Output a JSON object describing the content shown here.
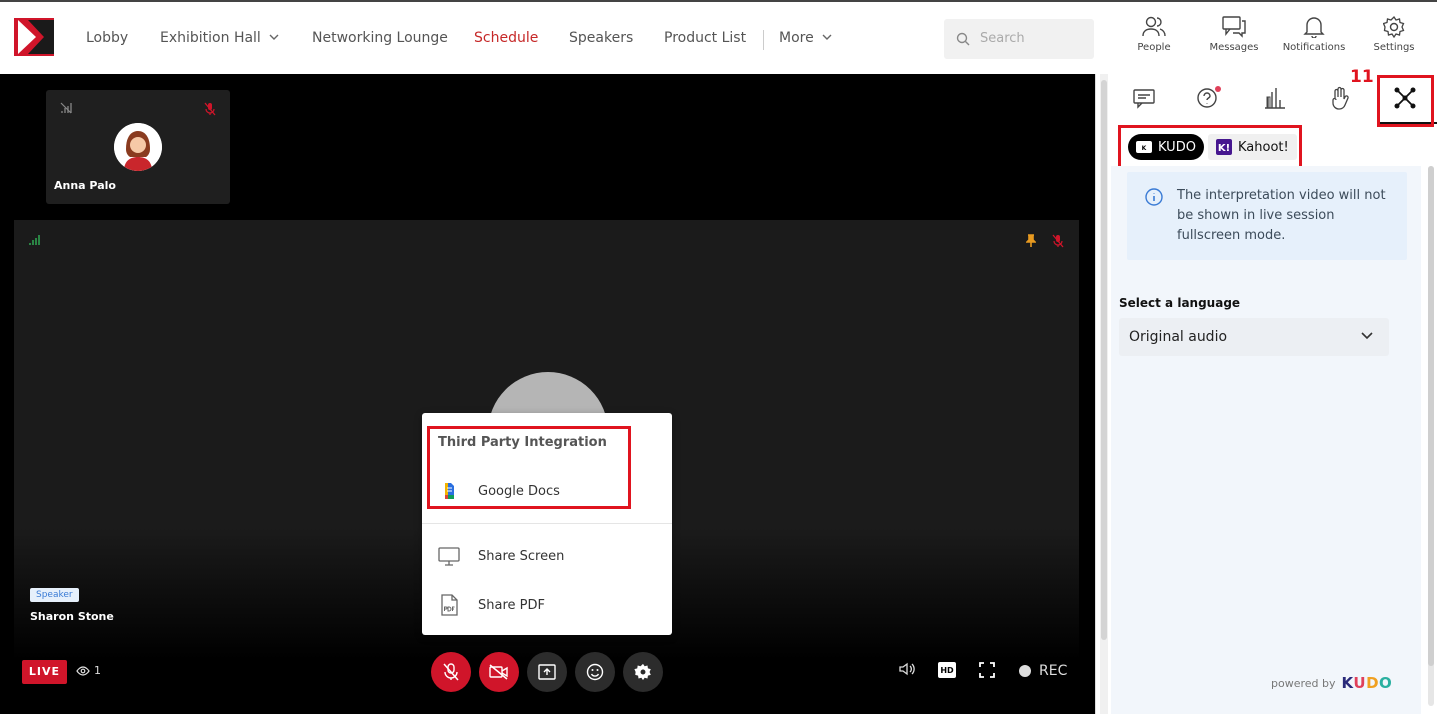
{
  "nav": {
    "items": [
      {
        "label": "Lobby"
      },
      {
        "label": "Exhibition Hall"
      },
      {
        "label": "Networking Lounge"
      },
      {
        "label": "Schedule"
      },
      {
        "label": "Speakers"
      },
      {
        "label": "Product List"
      },
      {
        "label": "More"
      }
    ],
    "active": "Schedule",
    "active_color": "#c62828"
  },
  "search": {
    "placeholder": "Search"
  },
  "top_icons": [
    {
      "label": "People",
      "icon": "people-icon"
    },
    {
      "label": "Messages",
      "icon": "messages-icon"
    },
    {
      "label": "Notifications",
      "icon": "bell-icon"
    },
    {
      "label": "Settings",
      "icon": "gear-icon"
    }
  ],
  "tile": {
    "name": "Anna Palo"
  },
  "main_video": {
    "badge": "Speaker",
    "name": "Sharon Stone"
  },
  "live": {
    "label": "LIVE",
    "viewers": "1"
  },
  "controls": {
    "hd": "HD",
    "rec": "REC"
  },
  "share_menu": {
    "header": "Third Party Integration",
    "items": [
      "Google Docs",
      "Share Screen",
      "Share PDF"
    ]
  },
  "annotation": {
    "number": "11",
    "color": "#e0141f"
  },
  "sidebar": {
    "integrations": [
      "KUDO",
      "Kahoot!"
    ],
    "info": "The interpretation video will not be shown in live session fullscreen mode.",
    "language_label": "Select a language",
    "language_value": "Original audio",
    "powered_by": "powered by",
    "brand": "KUDO"
  }
}
